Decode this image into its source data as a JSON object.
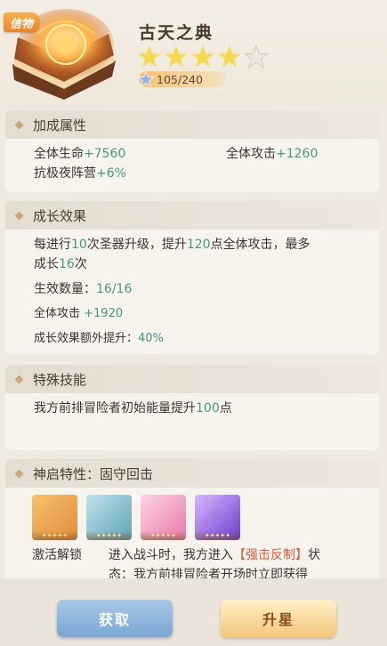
{
  "header": {
    "badge": "信物",
    "title": "古天之典",
    "stars_filled": 4,
    "stars_total": 5,
    "exp_text": "105/240"
  },
  "sections": {
    "bonus": {
      "title": "加成属性",
      "hp_label": "全体生命",
      "hp_value": "+7560",
      "atk_label": "全体攻击",
      "atk_value": "+1260",
      "resist_label": "抗极夜阵营",
      "resist_value": "+6%"
    },
    "growth": {
      "title": "成长效果",
      "line1_a": "每进行",
      "line1_b": "10",
      "line1_c": "次圣器升级，提升",
      "line1_d": "120",
      "line1_e": "点全体攻击，最多",
      "line2_a": "成长",
      "line2_b": "16",
      "line2_c": "次",
      "count_label": "生效数量：",
      "count_value": "16/16",
      "atk_label": "全体攻击 ",
      "atk_value": "+1920",
      "extra_label": "成长效果额外提升：",
      "extra_value": "40%"
    },
    "special": {
      "title": "特殊技能",
      "text_a": "我方前排冒险者初始能量提升",
      "text_b": "100",
      "text_c": "点"
    },
    "divine": {
      "title": "神启特性：固守回击",
      "unlock_label": "激活解锁",
      "desc_a": "进入战斗时，我方进入",
      "desc_b": "【强击反制】",
      "desc_c": "状",
      "desc_d": "态：我方前排冒险者开场时立即获得"
    }
  },
  "buttons": {
    "get": "获取",
    "upgrade": "升星"
  }
}
